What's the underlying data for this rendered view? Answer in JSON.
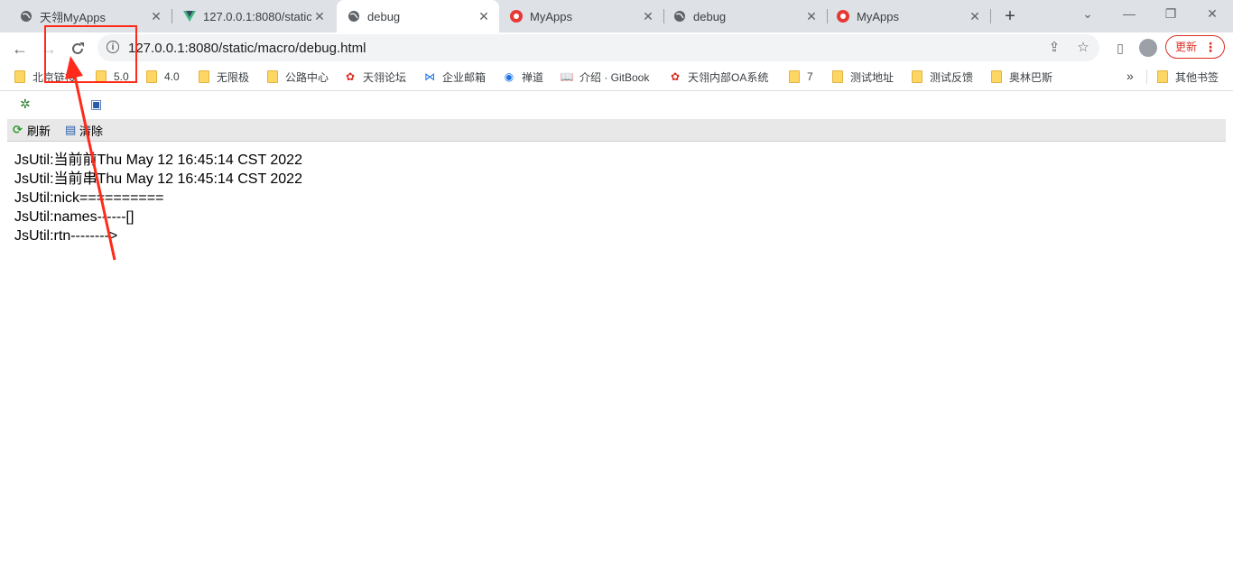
{
  "tabs": [
    {
      "label": "天翎MyApps",
      "icon": "globe-icon",
      "active": false
    },
    {
      "label": "127.0.0.1:8080/static",
      "icon": "vue-icon",
      "active": false
    },
    {
      "label": "debug",
      "icon": "globe-icon",
      "active": true
    },
    {
      "label": "MyApps",
      "icon": "myapps-icon",
      "active": false
    },
    {
      "label": "debug",
      "icon": "globe-icon",
      "active": false
    },
    {
      "label": "MyApps",
      "icon": "myapps-icon",
      "active": false
    }
  ],
  "address_bar": {
    "url": "127.0.0.1:8080/static/macro/debug.html"
  },
  "update_button": {
    "label": "更新"
  },
  "bookmarks": [
    {
      "label": "北京链接",
      "icon": "folder-icon"
    },
    {
      "label": "5.0",
      "icon": "folder-icon"
    },
    {
      "label": "4.0",
      "icon": "folder-icon"
    },
    {
      "label": "无限极",
      "icon": "folder-icon"
    },
    {
      "label": "公路中心",
      "icon": "folder-icon"
    },
    {
      "label": "天翎论坛",
      "icon": "myapps-icon"
    },
    {
      "label": "企业邮箱",
      "icon": "mail-icon"
    },
    {
      "label": "禅道",
      "icon": "zentao-icon"
    },
    {
      "label": "介绍 · GitBook",
      "icon": "book-icon"
    },
    {
      "label": "天翎内部OA系统",
      "icon": "myapps-icon"
    },
    {
      "label": "7",
      "icon": "folder-icon"
    },
    {
      "label": "测试地址",
      "icon": "folder-icon"
    },
    {
      "label": "测试反馈",
      "icon": "folder-icon"
    },
    {
      "label": "奥林巴斯",
      "icon": "folder-icon"
    }
  ],
  "other_bookmarks": {
    "label": "其他书签"
  },
  "debug_toolbar": {
    "refresh_label": "刷新",
    "clear_label": "清除"
  },
  "log_lines": [
    "JsUtil:当前前Thu May 12 16:45:14 CST 2022",
    "JsUtil:当前串Thu May 12 16:45:14 CST 2022",
    "JsUtil:nick==========",
    "JsUtil:names------[]",
    "JsUtil:rtn-------->"
  ],
  "colors": {
    "annotation": "#ff2a1a",
    "tabbar_bg": "#dee1e6",
    "update_accent": "#d93025"
  }
}
